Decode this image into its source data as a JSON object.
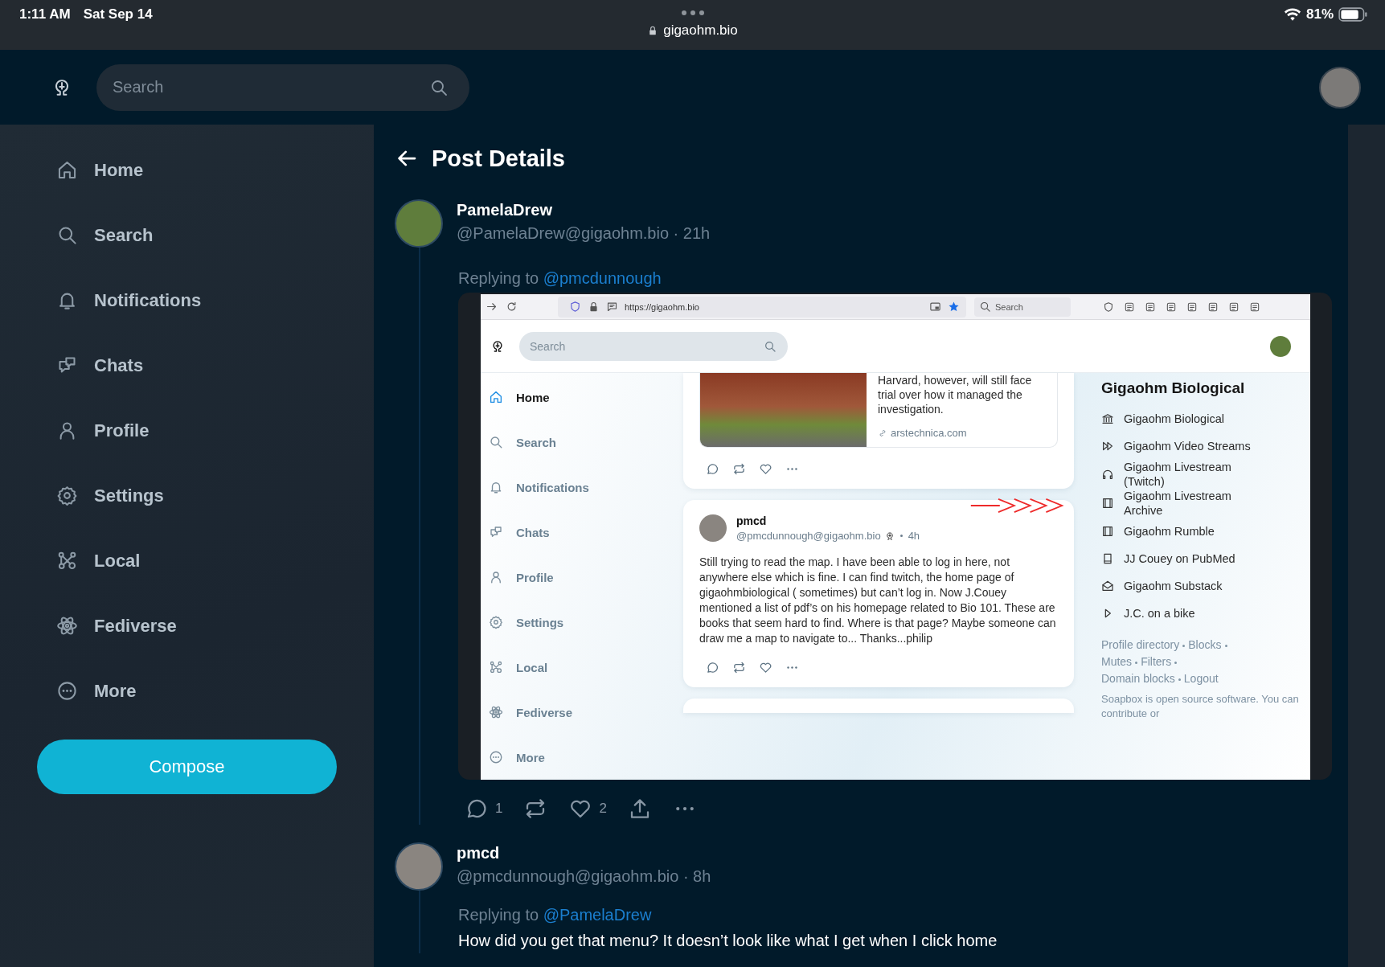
{
  "status_bar": {
    "time": "1:11 AM",
    "date": "Sat Sep 14",
    "url": "gigaohm.bio",
    "battery": "81%"
  },
  "header": {
    "search": {
      "placeholder": "Search"
    }
  },
  "sidebar": {
    "items": [
      {
        "label": "Home",
        "kind": "home"
      },
      {
        "label": "Search",
        "kind": "search"
      },
      {
        "label": "Notifications",
        "kind": "bell"
      },
      {
        "label": "Chats",
        "kind": "chats"
      },
      {
        "label": "Profile",
        "kind": "user"
      },
      {
        "label": "Settings",
        "kind": "gear"
      },
      {
        "label": "Local",
        "kind": "local"
      },
      {
        "label": "Fediverse",
        "kind": "atom"
      },
      {
        "label": "More",
        "kind": "more"
      }
    ],
    "compose": "Compose"
  },
  "page": {
    "title": "Post Details"
  },
  "posts": [
    {
      "name": "PamelaDrew",
      "handle": "@PamelaDrew@gigaohm.bio · 21h",
      "replying_prefix": "Replying to",
      "reply_to": "@pmcdunnough",
      "actions": [
        {
          "kind": "reply",
          "count": "1"
        },
        {
          "kind": "repost"
        },
        {
          "kind": "like",
          "count": "2"
        },
        {
          "kind": "share"
        },
        {
          "kind": "more"
        }
      ],
      "screenshot": {
        "browser": {
          "url": "https://gigaohm.bio",
          "search": "Search"
        },
        "header": {
          "search": {
            "placeholder": "Search"
          }
        },
        "sidebar": {
          "items": [
            {
              "label": "Home",
              "kind": "home",
              "selected": true
            },
            {
              "label": "Search",
              "kind": "search",
              "selected": false
            },
            {
              "label": "Notifications",
              "kind": "bell",
              "selected": false
            },
            {
              "label": "Chats",
              "kind": "chats",
              "selected": false
            },
            {
              "label": "Profile",
              "kind": "user",
              "selected": false
            },
            {
              "label": "Settings",
              "kind": "gear",
              "selected": false
            },
            {
              "label": "Local",
              "kind": "local",
              "selected": false
            },
            {
              "label": "Fediverse",
              "kind": "atom",
              "selected": false
            },
            {
              "label": "More",
              "kind": "more",
              "selected": false
            }
          ]
        },
        "feed": [
          {
            "kind": "link_card",
            "text": "Harvard, however, will still face trial over how it managed the investigation.",
            "source": "arstechnica.com"
          },
          {
            "kind": "post",
            "name": "pmcd",
            "handle": "@pmcdunnough@gigaohm.bio",
            "time": "4h",
            "body": "Still trying to read the map. I have been able to log in here, not anywhere else which is fine. I can find twitch, the home page of gigaohmbiological ( sometimes) but can’t log in. Now J.Couey mentioned a list of pdf’s on his homepage related to Bio 101. These are books that seem hard to find. Where is that page? Maybe someone can draw me a map to navigate to... Thanks...philip"
          },
          {
            "kind": "empty"
          }
        ],
        "panel": {
          "title": "Gigaohm Biological",
          "links": [
            {
              "label": "Gigaohm Biological",
              "kind": "bank"
            },
            {
              "label": "Gigaohm Video Streams",
              "kind": "forward"
            },
            {
              "label": "Gigaohm Livestream (Twitch)",
              "kind": "headphones"
            },
            {
              "label": "Gigaohm Livestream Archive",
              "kind": "film"
            },
            {
              "label": "Gigaohm Rumble",
              "kind": "film"
            },
            {
              "label": "JJ Couey on PubMed",
              "kind": "book"
            },
            {
              "label": "Gigaohm Substack",
              "kind": "mail"
            },
            {
              "label": "J.C. on a bike",
              "kind": "play"
            }
          ],
          "footer_links": [
            "Profile directory",
            "Blocks",
            "Mutes",
            "Filters",
            "Domain blocks",
            "Logout"
          ],
          "note": "Soapbox is open source software. You can contribute or"
        }
      }
    },
    {
      "name": "pmcd",
      "handle": "@pmcdunnough@gigaohm.bio · 8h",
      "replying_prefix": "Replying to",
      "reply_to": "@PamelaDrew",
      "body": "How did you get that menu? It doesn’t look like what I get when I click home"
    }
  ]
}
